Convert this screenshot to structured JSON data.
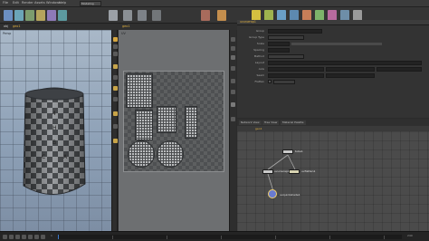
{
  "menubar": {
    "items": [
      "File",
      "Edit",
      "Render",
      "Assets",
      "Windows",
      "Help"
    ],
    "desktop": "Modeling"
  },
  "pathbar": {
    "obj": "obj",
    "geo": "geo1"
  },
  "viewport_3d": {
    "label": "Persp"
  },
  "viewport_uv": {
    "label": "UV"
  },
  "params": {
    "node_title": "uvunwrap1",
    "rows": [
      "Group",
      "Group Type",
      "Scale",
      "Spacing",
      "Method",
      "Layout",
      "Axis",
      "Seam",
      "Flatten"
    ]
  },
  "network": {
    "tabs": [
      "Network View",
      "Tree View",
      "Material Palette"
    ],
    "path": "geo1",
    "nodes": [
      {
        "name": "tube1",
        "color": "#c9c9c9"
      },
      {
        "name": "uvflatten1",
        "color": "#d7d3b2"
      },
      {
        "name": "uvunwrap1",
        "color": "#c9c9c9"
      },
      {
        "name": "uvquickshade1",
        "color": "#6a7bd1"
      }
    ]
  },
  "timeline": {
    "frame": "1",
    "end": "240"
  },
  "colors": {
    "accent": "#e0b040",
    "node_selected": "#f0d070"
  }
}
